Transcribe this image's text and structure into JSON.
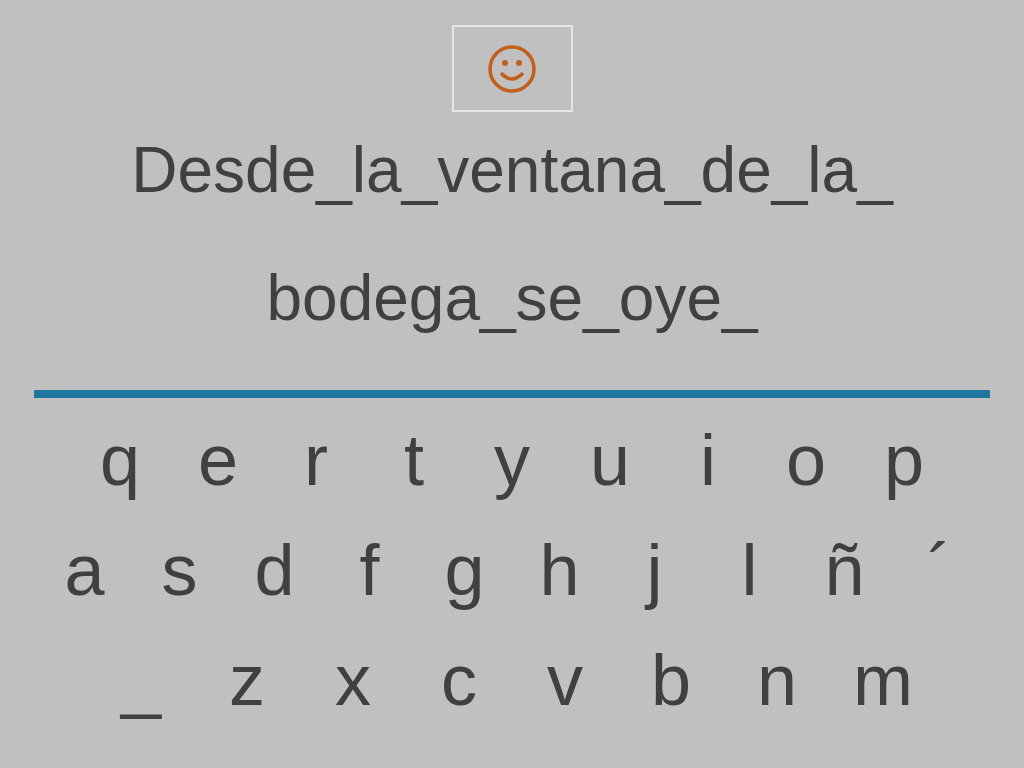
{
  "prompt_lines": [
    "Desde_la_ventana_de_la_",
    "bodega_se_oye_"
  ],
  "keyboard_rows": [
    [
      "q",
      "e",
      "r",
      "t",
      "y",
      "u",
      "i",
      "o",
      "p"
    ],
    [
      "a",
      "s",
      "d",
      "f",
      "g",
      "h",
      "j",
      "l",
      "ñ",
      "´"
    ],
    [
      "_",
      "z",
      "x",
      "c",
      "v",
      "b",
      "n",
      "m"
    ]
  ]
}
